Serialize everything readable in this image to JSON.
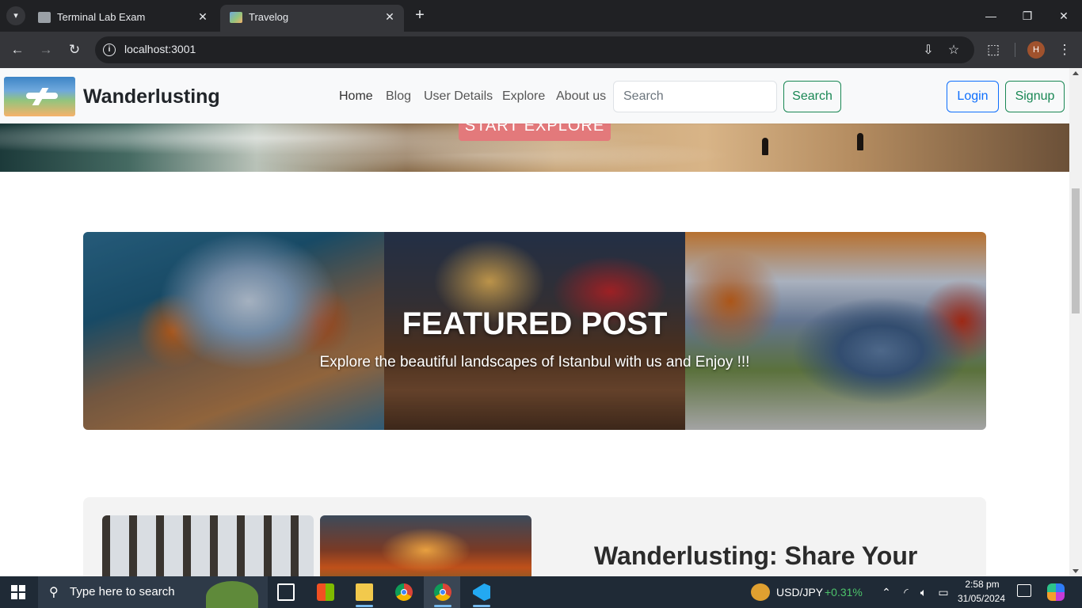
{
  "browser": {
    "tabs": [
      {
        "title": "Terminal Lab Exam",
        "active": false
      },
      {
        "title": "Travelog",
        "active": true
      }
    ],
    "url": "localhost:3001",
    "profile_initial": "H"
  },
  "navbar": {
    "brand": "Wanderlusting",
    "links": [
      "Home",
      "Blog",
      "User Details",
      "Explore",
      "About us"
    ],
    "search_placeholder": "Search",
    "search_button": "Search",
    "login": "Login",
    "signup": "Signup"
  },
  "hero": {
    "button": "START EXPLORE"
  },
  "featured": {
    "title": "FEATURED POST",
    "subtitle": "Explore the beautiful landscapes of Istanbul with us and Enjoy !!!"
  },
  "blog_card": {
    "title": "Wanderlusting: Share Your"
  },
  "taskbar": {
    "search_placeholder": "Type here to search",
    "ticker_label": "USD/JPY",
    "ticker_change": "+0.31%",
    "time": "2:58 pm",
    "date": "31/05/2024"
  },
  "colors": {
    "brand_green": "#198754",
    "brand_blue": "#0d6efd",
    "hero_button": "#e3797b"
  }
}
